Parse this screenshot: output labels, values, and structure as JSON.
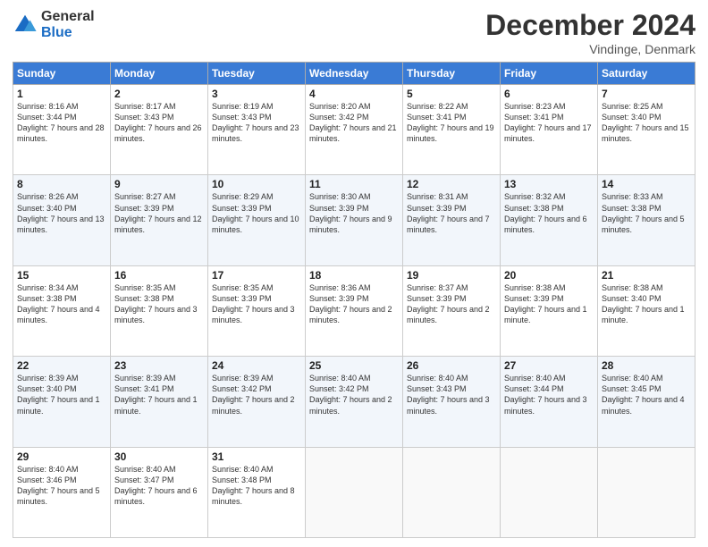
{
  "logo": {
    "general": "General",
    "blue": "Blue"
  },
  "header": {
    "month": "December 2024",
    "location": "Vindinge, Denmark"
  },
  "weekdays": [
    "Sunday",
    "Monday",
    "Tuesday",
    "Wednesday",
    "Thursday",
    "Friday",
    "Saturday"
  ],
  "weeks": [
    [
      {
        "day": "1",
        "sunrise": "Sunrise: 8:16 AM",
        "sunset": "Sunset: 3:44 PM",
        "daylight": "Daylight: 7 hours and 28 minutes."
      },
      {
        "day": "2",
        "sunrise": "Sunrise: 8:17 AM",
        "sunset": "Sunset: 3:43 PM",
        "daylight": "Daylight: 7 hours and 26 minutes."
      },
      {
        "day": "3",
        "sunrise": "Sunrise: 8:19 AM",
        "sunset": "Sunset: 3:43 PM",
        "daylight": "Daylight: 7 hours and 23 minutes."
      },
      {
        "day": "4",
        "sunrise": "Sunrise: 8:20 AM",
        "sunset": "Sunset: 3:42 PM",
        "daylight": "Daylight: 7 hours and 21 minutes."
      },
      {
        "day": "5",
        "sunrise": "Sunrise: 8:22 AM",
        "sunset": "Sunset: 3:41 PM",
        "daylight": "Daylight: 7 hours and 19 minutes."
      },
      {
        "day": "6",
        "sunrise": "Sunrise: 8:23 AM",
        "sunset": "Sunset: 3:41 PM",
        "daylight": "Daylight: 7 hours and 17 minutes."
      },
      {
        "day": "7",
        "sunrise": "Sunrise: 8:25 AM",
        "sunset": "Sunset: 3:40 PM",
        "daylight": "Daylight: 7 hours and 15 minutes."
      }
    ],
    [
      {
        "day": "8",
        "sunrise": "Sunrise: 8:26 AM",
        "sunset": "Sunset: 3:40 PM",
        "daylight": "Daylight: 7 hours and 13 minutes."
      },
      {
        "day": "9",
        "sunrise": "Sunrise: 8:27 AM",
        "sunset": "Sunset: 3:39 PM",
        "daylight": "Daylight: 7 hours and 12 minutes."
      },
      {
        "day": "10",
        "sunrise": "Sunrise: 8:29 AM",
        "sunset": "Sunset: 3:39 PM",
        "daylight": "Daylight: 7 hours and 10 minutes."
      },
      {
        "day": "11",
        "sunrise": "Sunrise: 8:30 AM",
        "sunset": "Sunset: 3:39 PM",
        "daylight": "Daylight: 7 hours and 9 minutes."
      },
      {
        "day": "12",
        "sunrise": "Sunrise: 8:31 AM",
        "sunset": "Sunset: 3:39 PM",
        "daylight": "Daylight: 7 hours and 7 minutes."
      },
      {
        "day": "13",
        "sunrise": "Sunrise: 8:32 AM",
        "sunset": "Sunset: 3:38 PM",
        "daylight": "Daylight: 7 hours and 6 minutes."
      },
      {
        "day": "14",
        "sunrise": "Sunrise: 8:33 AM",
        "sunset": "Sunset: 3:38 PM",
        "daylight": "Daylight: 7 hours and 5 minutes."
      }
    ],
    [
      {
        "day": "15",
        "sunrise": "Sunrise: 8:34 AM",
        "sunset": "Sunset: 3:38 PM",
        "daylight": "Daylight: 7 hours and 4 minutes."
      },
      {
        "day": "16",
        "sunrise": "Sunrise: 8:35 AM",
        "sunset": "Sunset: 3:38 PM",
        "daylight": "Daylight: 7 hours and 3 minutes."
      },
      {
        "day": "17",
        "sunrise": "Sunrise: 8:35 AM",
        "sunset": "Sunset: 3:39 PM",
        "daylight": "Daylight: 7 hours and 3 minutes."
      },
      {
        "day": "18",
        "sunrise": "Sunrise: 8:36 AM",
        "sunset": "Sunset: 3:39 PM",
        "daylight": "Daylight: 7 hours and 2 minutes."
      },
      {
        "day": "19",
        "sunrise": "Sunrise: 8:37 AM",
        "sunset": "Sunset: 3:39 PM",
        "daylight": "Daylight: 7 hours and 2 minutes."
      },
      {
        "day": "20",
        "sunrise": "Sunrise: 8:38 AM",
        "sunset": "Sunset: 3:39 PM",
        "daylight": "Daylight: 7 hours and 1 minute."
      },
      {
        "day": "21",
        "sunrise": "Sunrise: 8:38 AM",
        "sunset": "Sunset: 3:40 PM",
        "daylight": "Daylight: 7 hours and 1 minute."
      }
    ],
    [
      {
        "day": "22",
        "sunrise": "Sunrise: 8:39 AM",
        "sunset": "Sunset: 3:40 PM",
        "daylight": "Daylight: 7 hours and 1 minute."
      },
      {
        "day": "23",
        "sunrise": "Sunrise: 8:39 AM",
        "sunset": "Sunset: 3:41 PM",
        "daylight": "Daylight: 7 hours and 1 minute."
      },
      {
        "day": "24",
        "sunrise": "Sunrise: 8:39 AM",
        "sunset": "Sunset: 3:42 PM",
        "daylight": "Daylight: 7 hours and 2 minutes."
      },
      {
        "day": "25",
        "sunrise": "Sunrise: 8:40 AM",
        "sunset": "Sunset: 3:42 PM",
        "daylight": "Daylight: 7 hours and 2 minutes."
      },
      {
        "day": "26",
        "sunrise": "Sunrise: 8:40 AM",
        "sunset": "Sunset: 3:43 PM",
        "daylight": "Daylight: 7 hours and 3 minutes."
      },
      {
        "day": "27",
        "sunrise": "Sunrise: 8:40 AM",
        "sunset": "Sunset: 3:44 PM",
        "daylight": "Daylight: 7 hours and 3 minutes."
      },
      {
        "day": "28",
        "sunrise": "Sunrise: 8:40 AM",
        "sunset": "Sunset: 3:45 PM",
        "daylight": "Daylight: 7 hours and 4 minutes."
      }
    ],
    [
      {
        "day": "29",
        "sunrise": "Sunrise: 8:40 AM",
        "sunset": "Sunset: 3:46 PM",
        "daylight": "Daylight: 7 hours and 5 minutes."
      },
      {
        "day": "30",
        "sunrise": "Sunrise: 8:40 AM",
        "sunset": "Sunset: 3:47 PM",
        "daylight": "Daylight: 7 hours and 6 minutes."
      },
      {
        "day": "31",
        "sunrise": "Sunrise: 8:40 AM",
        "sunset": "Sunset: 3:48 PM",
        "daylight": "Daylight: 7 hours and 8 minutes."
      },
      null,
      null,
      null,
      null
    ]
  ]
}
